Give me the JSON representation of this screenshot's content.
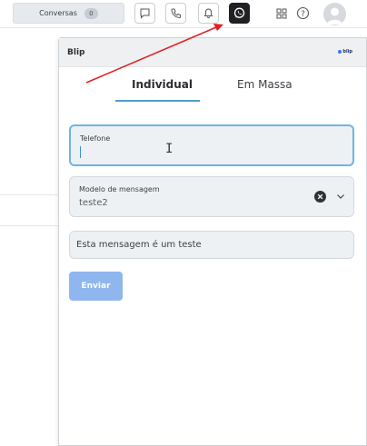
{
  "toolbar": {
    "conversas_label": "Conversas",
    "conversas_count": "0",
    "icons": [
      "chat-bubble-icon",
      "phone-icon",
      "bell-icon",
      "whatsapp-icon",
      "grid-icon",
      "help-icon",
      "avatar-icon"
    ]
  },
  "panel": {
    "title": "Blip",
    "logo_text": "blip",
    "tabs": [
      {
        "label": "Individual",
        "active": true
      },
      {
        "label": "Em Massa",
        "active": false
      }
    ],
    "phone": {
      "label": "Telefone",
      "value": ""
    },
    "template": {
      "label": "Modelo de mensagem",
      "value": "teste2"
    },
    "message": {
      "value": "Esta mensagem é um teste"
    },
    "send_label": "Enviar"
  },
  "colors": {
    "accent": "#4fa0c8",
    "focus_border": "#6fb4e6",
    "send_button": "#8fb6ee",
    "annotation_arrow": "#e02020",
    "active_tool": "#1f2023"
  }
}
